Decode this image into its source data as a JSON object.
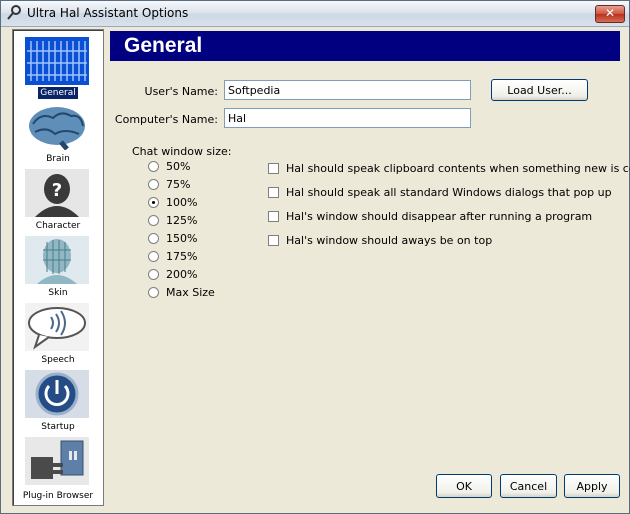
{
  "window": {
    "title": "Ultra Hal Assistant Options",
    "close_glyph": "✕"
  },
  "sidebar": {
    "items": [
      {
        "label": "General",
        "icon": "general-icon",
        "active": true
      },
      {
        "label": "Brain",
        "icon": "brain-icon"
      },
      {
        "label": "Character",
        "icon": "character-icon"
      },
      {
        "label": "Skin",
        "icon": "skin-icon"
      },
      {
        "label": "Speech",
        "icon": "speech-icon"
      },
      {
        "label": "Startup",
        "icon": "startup-icon"
      },
      {
        "label": "Plug-in Browser",
        "icon": "plugin-icon"
      }
    ]
  },
  "header": {
    "title": "General"
  },
  "form": {
    "users_name_label": "User's Name:",
    "users_name_value": "Softpedia",
    "computers_name_label": "Computer's Name:",
    "computers_name_value": "Hal",
    "load_user_label": "Load User..."
  },
  "chat_size": {
    "label": "Chat window size:",
    "options": [
      "50%",
      "75%",
      "100%",
      "125%",
      "150%",
      "175%",
      "200%",
      "Max Size"
    ],
    "selected": "100%"
  },
  "checkboxes": [
    {
      "label": "Hal should speak clipboard contents when something new is copied",
      "checked": false
    },
    {
      "label": "Hal should speak all standard Windows dialogs that pop up",
      "checked": false
    },
    {
      "label": "Hal's window should disappear after running a program",
      "checked": false
    },
    {
      "label": "Hal's window should aways be on top",
      "checked": false
    }
  ],
  "buttons": {
    "ok": "OK",
    "cancel": "Cancel",
    "apply": "Apply"
  },
  "colors": {
    "header_bg": "#000080",
    "selection": "#0a246a"
  }
}
